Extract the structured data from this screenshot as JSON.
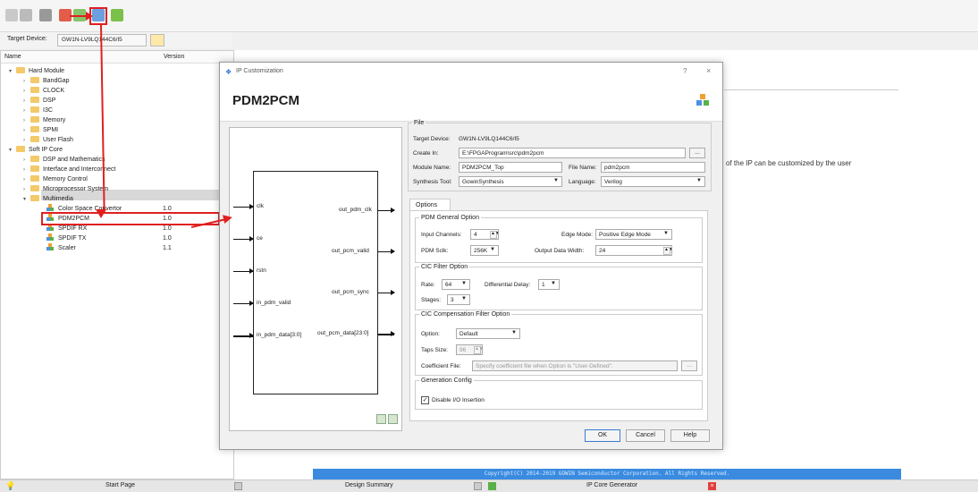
{
  "toolbar": {
    "target_label": "Target Device:",
    "target_value": "GW1N-LV9LQ144C6/I5"
  },
  "tree": {
    "col_name": "Name",
    "col_version": "Version",
    "nodes": [
      {
        "label": "Hard Module"
      },
      {
        "label": "BandGap"
      },
      {
        "label": "CLOCK"
      },
      {
        "label": "DSP"
      },
      {
        "label": "I3C"
      },
      {
        "label": "Memory"
      },
      {
        "label": "SPMI"
      },
      {
        "label": "User Flash"
      },
      {
        "label": "Soft IP Core"
      },
      {
        "label": "DSP and Mathematics"
      },
      {
        "label": "Interface and Interconnect"
      },
      {
        "label": "Memory Control"
      },
      {
        "label": "Microprocessor System"
      },
      {
        "label": "Multimedia"
      },
      {
        "label": "Color Space Convertor",
        "version": "1.0"
      },
      {
        "label": "PDM2PCM",
        "version": "1.0"
      },
      {
        "label": "SPDIF RX",
        "version": "1.0"
      },
      {
        "label": "SPDIF TX",
        "version": "1.0"
      },
      {
        "label": "Scaler",
        "version": "1.1"
      }
    ]
  },
  "dialog": {
    "title": "IP Customization",
    "help": "?",
    "close": "×",
    "heading": "PDM2PCM",
    "diagram": {
      "inputs": [
        "clk",
        "ce",
        "rstn",
        "in_pdm_valid",
        "in_pdm_data[3:0]"
      ],
      "outputs": [
        "out_pdm_clk",
        "out_pcm_valid",
        "out_pcm_sync",
        "out_pcm_data[23:0]"
      ]
    },
    "file": {
      "legend": "File",
      "target_label": "Target Device:",
      "target_value": "GW1N-LV9LQ144C6/I5",
      "create_label": "Create In:",
      "create_value": "E:\\FPGAProgram\\src\\pdm2pcm",
      "browse": "...",
      "module_label": "Module Name:",
      "module_value": "PDM2PCM_Top",
      "filename_label": "File Name:",
      "filename_value": "pdm2pcm",
      "synth_label": "Synthesis Tool:",
      "synth_value": "GowinSynthesis",
      "lang_label": "Language:",
      "lang_value": "Verilog"
    },
    "options_tab": "Options",
    "pdm": {
      "legend": "PDM General Option",
      "channels_label": "Input Channels:",
      "channels_value": "4",
      "edge_label": "Edge Mode:",
      "edge_value": "Positive Edge Mode",
      "sclk_label": "PDM Sclk:",
      "sclk_value": "256K",
      "width_label": "Output Data Width:",
      "width_value": "24"
    },
    "cic": {
      "legend": "CIC Filter Option",
      "rate_label": "Rate:",
      "rate_value": "64",
      "delay_label": "Differential Delay:",
      "delay_value": "1",
      "stages_label": "Stages:",
      "stages_value": "3"
    },
    "comp": {
      "legend": "CIC Compensation Filter Option",
      "option_label": "Option:",
      "option_value": "Default",
      "taps_label": "Taps Size:",
      "taps_value": "96",
      "coef_label": "Coefficient File:",
      "coef_placeholder": "Specify coefficient file when Option is \"User-Defined\".",
      "coef_browse": "..."
    },
    "gen": {
      "legend": "Generation Config",
      "disable_io": "Disable I/O Insertion"
    },
    "ok": "OK",
    "cancel": "Cancel",
    "helpbtn": "Help"
  },
  "right_text": "of the IP can be customized by the user",
  "copyright": "Copyright(C) 2014-2019 GOWIN Semiconductor Corporation. All Rights Reserved.",
  "tabs": {
    "start": "Start Page",
    "summary": "Design Summary",
    "ipgen": "IP Core Generator"
  },
  "colors": {
    "accent": "#3a8be0",
    "highlight": "#e02020"
  }
}
